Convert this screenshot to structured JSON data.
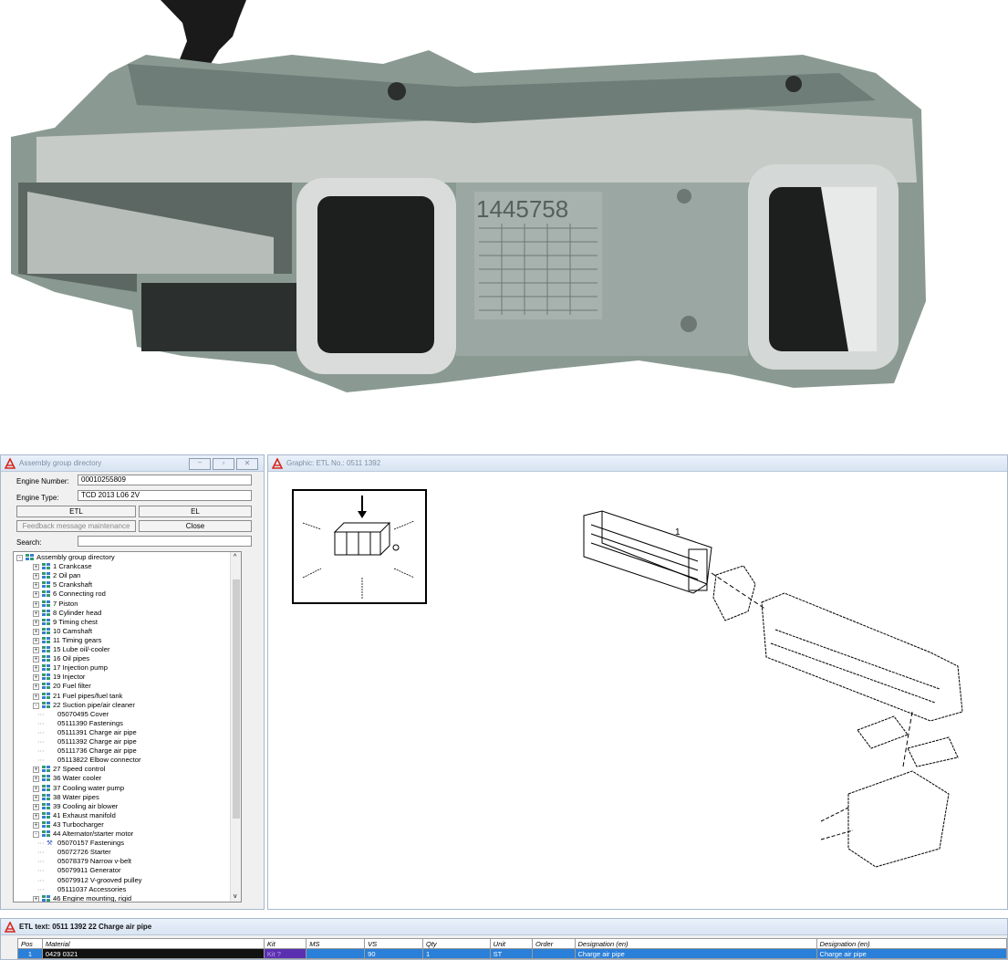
{
  "photo": {
    "part_number": "1445758"
  },
  "assembly_window": {
    "title": "Assembly group directory",
    "engine_number_label": "Engine Number:",
    "engine_number": "00010255809",
    "engine_type_label": "Engine Type:",
    "engine_type": "TCD 2013 L06 2V",
    "etl_button": "ETL",
    "el_button": "EL",
    "feedback_button": "Feedback message maintenance",
    "close_button": "Close",
    "search_label": "Search:",
    "search_value": "",
    "tree": [
      {
        "label": "Assembly group directory",
        "level": 0,
        "toggle": "-"
      },
      {
        "label": "1  Crankcase",
        "level": 1,
        "toggle": "+"
      },
      {
        "label": "2  Oil pan",
        "level": 1,
        "toggle": "+"
      },
      {
        "label": "5  Crankshaft",
        "level": 1,
        "toggle": "+"
      },
      {
        "label": "6  Connecting rod",
        "level": 1,
        "toggle": "+"
      },
      {
        "label": "7  Piston",
        "level": 1,
        "toggle": "+"
      },
      {
        "label": "8  Cylinder head",
        "level": 1,
        "toggle": "+"
      },
      {
        "label": "9  Timing chest",
        "level": 1,
        "toggle": "+"
      },
      {
        "label": "10  Camshaft",
        "level": 1,
        "toggle": "+"
      },
      {
        "label": "11  Timing gears",
        "level": 1,
        "toggle": "+"
      },
      {
        "label": "15  Lube oil/-cooler",
        "level": 1,
        "toggle": "+"
      },
      {
        "label": "16  Oil pipes",
        "level": 1,
        "toggle": "+"
      },
      {
        "label": "17  Injection pump",
        "level": 1,
        "toggle": "+"
      },
      {
        "label": "19  Injector",
        "level": 1,
        "toggle": "+"
      },
      {
        "label": "20  Fuel filter",
        "level": 1,
        "toggle": "+"
      },
      {
        "label": "21  Fuel pipes/fuel tank",
        "level": 1,
        "toggle": "+"
      },
      {
        "label": "22  Suction pipe/air cleaner",
        "level": 1,
        "toggle": "-"
      },
      {
        "label": "05070495  Cover",
        "level": 2,
        "toggle": ""
      },
      {
        "label": "05111390  Fastenings",
        "level": 2,
        "toggle": ""
      },
      {
        "label": "05111391  Charge air pipe",
        "level": 2,
        "toggle": ""
      },
      {
        "label": "05111392  Charge air pipe",
        "level": 2,
        "toggle": ""
      },
      {
        "label": "05111736  Charge air pipe",
        "level": 2,
        "toggle": ""
      },
      {
        "label": "05113822  Elbow connector",
        "level": 2,
        "toggle": ""
      },
      {
        "label": "27  Speed control",
        "level": 1,
        "toggle": "+"
      },
      {
        "label": "36  Water cooler",
        "level": 1,
        "toggle": "+"
      },
      {
        "label": "37  Cooling water pump",
        "level": 1,
        "toggle": "+"
      },
      {
        "label": "38  Water pipes",
        "level": 1,
        "toggle": "+"
      },
      {
        "label": "39  Cooling air blower",
        "level": 1,
        "toggle": "+"
      },
      {
        "label": "41  Exhaust manifold",
        "level": 1,
        "toggle": "+"
      },
      {
        "label": "43  Turbocharger",
        "level": 1,
        "toggle": "+"
      },
      {
        "label": "44  Alternator/starter motor",
        "level": 1,
        "toggle": "-"
      },
      {
        "label": "05070157  Fastenings",
        "level": 2,
        "toggle": "",
        "icon": "wrench"
      },
      {
        "label": "05072726  Starter",
        "level": 2,
        "toggle": ""
      },
      {
        "label": "05078379  Narrow v-belt",
        "level": 2,
        "toggle": ""
      },
      {
        "label": "05079911  Generator",
        "level": 2,
        "toggle": ""
      },
      {
        "label": "05079912  V-grooved pulley",
        "level": 2,
        "toggle": ""
      },
      {
        "label": "05111037  Accessories",
        "level": 2,
        "toggle": ""
      },
      {
        "label": "46  Engine mounting, rigid",
        "level": 1,
        "toggle": "+"
      }
    ]
  },
  "graphic_window": {
    "title": "Graphic: ETL No.: 0511 1392",
    "callout": "1"
  },
  "etl_window": {
    "title": "ETL text: 0511 1392   22   Charge air pipe",
    "columns": [
      "Pos",
      "Material",
      "Kit",
      "MS",
      "VS",
      "Qty",
      "Unit",
      "Order",
      "Designation (en)",
      "Designation (en)"
    ],
    "rows": [
      [
        "1",
        "0429 0321",
        "Kit ?",
        "",
        "90",
        "1",
        "ST",
        "",
        "Charge air pipe",
        "Charge air pipe"
      ]
    ]
  }
}
